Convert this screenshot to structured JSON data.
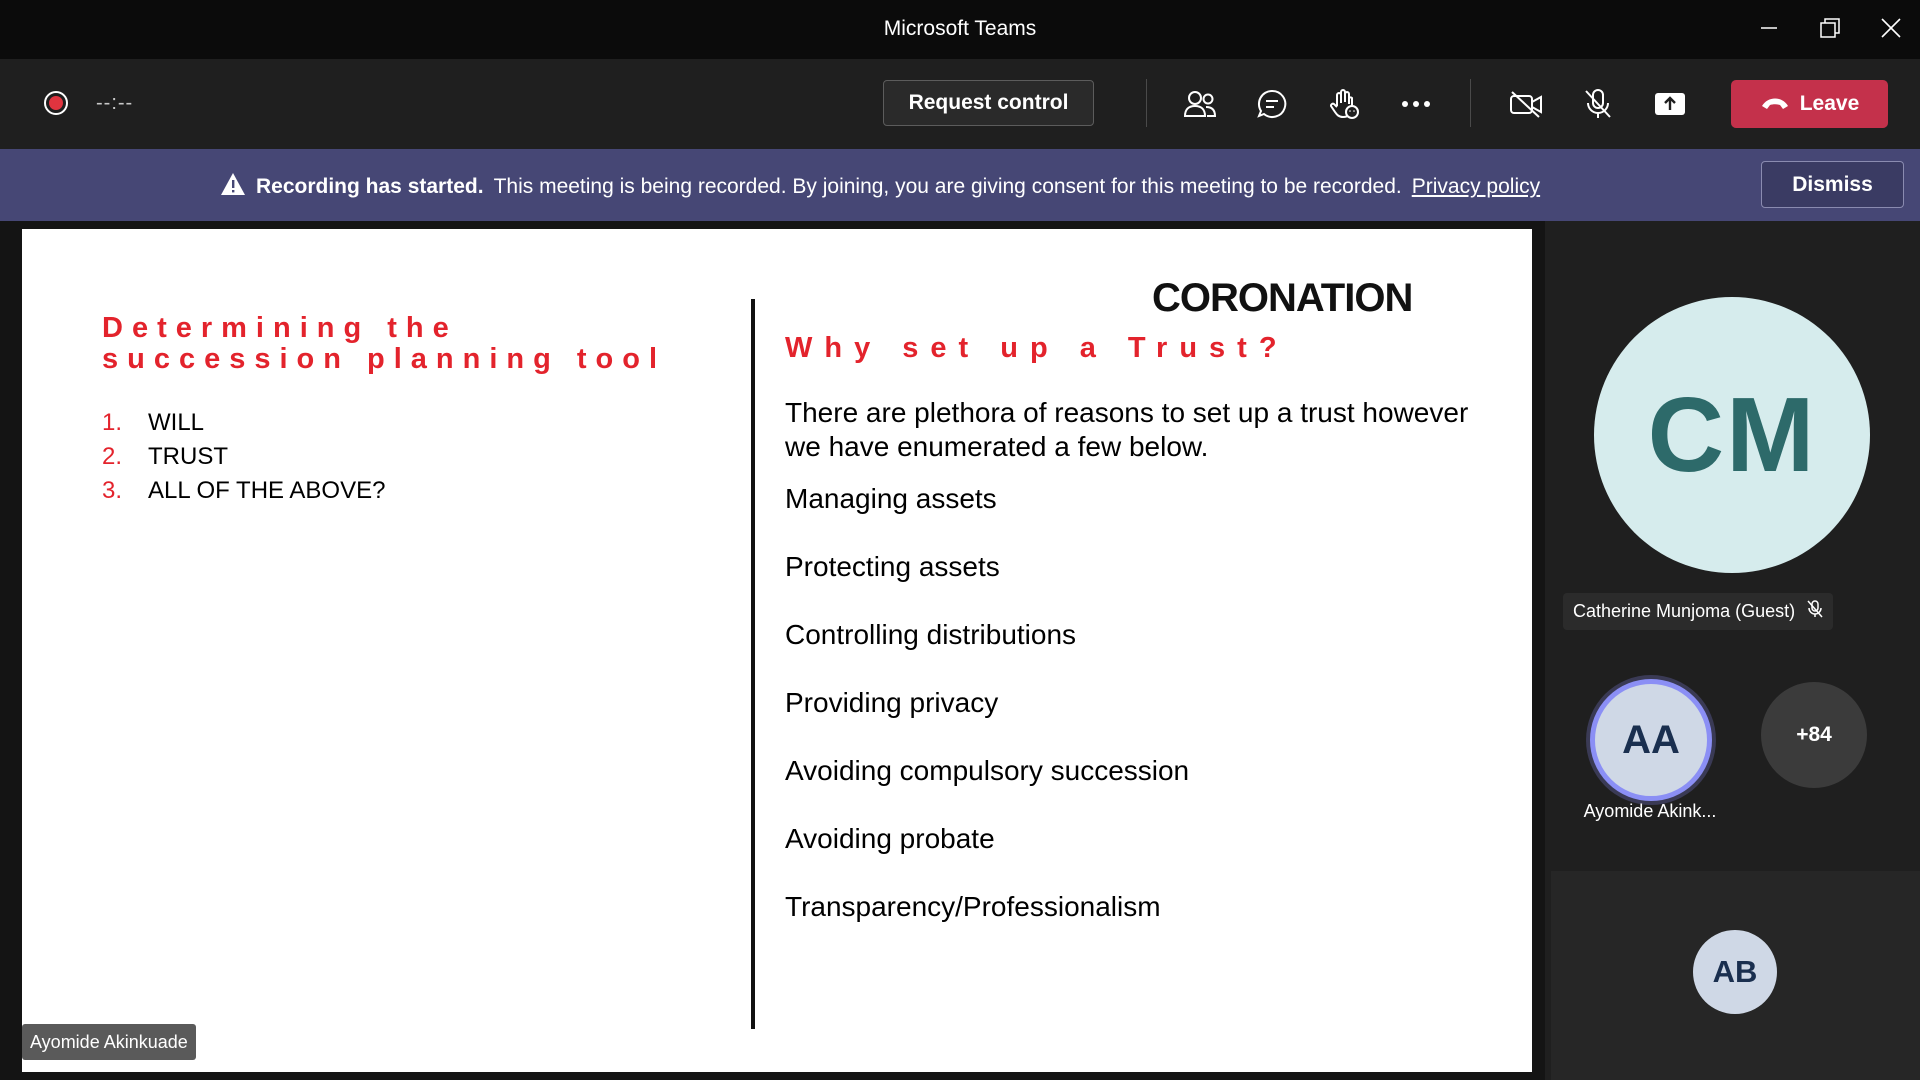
{
  "window": {
    "title": "Microsoft Teams"
  },
  "toolbar": {
    "timer": "--:--",
    "request_control": "Request control",
    "leave": "Leave",
    "icons": [
      "participants-icon",
      "chat-icon",
      "raise-hand-icon",
      "more-icon",
      "camera-off-icon",
      "mic-off-icon",
      "share-icon"
    ]
  },
  "banner": {
    "bold": "Recording has started.",
    "text": "This meeting is being recorded. By joining, you are giving consent for this meeting to be recorded.",
    "link": "Privacy policy",
    "dismiss": "Dismiss"
  },
  "slide": {
    "left_title": "Determining the succession planning tool",
    "options": [
      {
        "num": "1.",
        "label": "WILL"
      },
      {
        "num": "2.",
        "label": "TRUST"
      },
      {
        "num": "3.",
        "label": "ALL OF THE ABOVE?"
      }
    ],
    "brand": "CORONATION",
    "right_title": "Why set up a Trust?",
    "intro": "There are  plethora of reasons to set up a trust  however we have enumerated a few below.",
    "reasons": [
      "Managing assets",
      "Protecting assets",
      "Controlling distributions",
      "Providing privacy",
      "Avoiding compulsory succession",
      "Avoiding probate",
      "Transparency/Professionalism"
    ]
  },
  "presenter": {
    "name": "Ayomide Akinkuade"
  },
  "participants": {
    "main": {
      "initials": "CM",
      "name": "Catherine Munjoma (Guest)"
    },
    "speaker": {
      "initials": "AA",
      "name": "Ayomide Akink..."
    },
    "more": "+84",
    "other": {
      "initials": "AB"
    }
  },
  "colors": {
    "accent_red": "#e3232c",
    "banner": "#464775",
    "leave": "#c4314b"
  }
}
